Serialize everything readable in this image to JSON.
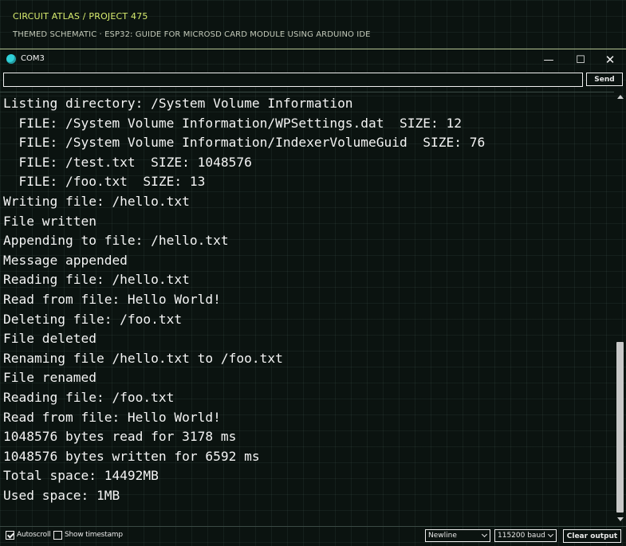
{
  "header": {
    "breadcrumb": "CIRCUIT ATLAS / PROJECT 475",
    "subtitle": "THEMED SCHEMATIC · ESP32: GUIDE FOR MICROSD CARD MODULE USING ARDUINO IDE"
  },
  "window": {
    "title": "COM3",
    "icon": "serial-monitor-icon",
    "controls": {
      "minimize": "—",
      "maximize": "☐",
      "close": "✕"
    }
  },
  "input": {
    "value": "",
    "placeholder": "",
    "send_label": "Send"
  },
  "output": {
    "lines": [
      "Listing directory: /System Volume Information",
      "  FILE: /System Volume Information/WPSettings.dat  SIZE: 12",
      "  FILE: /System Volume Information/IndexerVolumeGuid  SIZE: 76",
      "  FILE: /test.txt  SIZE: 1048576",
      "  FILE: /foo.txt  SIZE: 13",
      "Writing file: /hello.txt",
      "File written",
      "Appending to file: /hello.txt",
      "Message appended",
      "Reading file: /hello.txt",
      "Read from file: Hello World!",
      "Deleting file: /foo.txt",
      "File deleted",
      "Renaming file /hello.txt to /foo.txt",
      "File renamed",
      "Reading file: /foo.txt",
      "Read from file: Hello World!",
      "1048576 bytes read for 3178 ms",
      "1048576 bytes written for 6592 ms",
      "Total space: 14492MB",
      "Used space: 1MB"
    ]
  },
  "footer": {
    "autoscroll_label": "Autoscroll",
    "autoscroll_checked": true,
    "timestamp_label": "Show timestamp",
    "timestamp_checked": false,
    "line_ending": "Newline",
    "baud_rate": "115200 baud",
    "clear_label": "Clear output"
  },
  "colors": {
    "background": "#0b1310",
    "accent": "#d8ec6e",
    "text": "#f4f4f4",
    "icon": "#2fd0d8"
  }
}
